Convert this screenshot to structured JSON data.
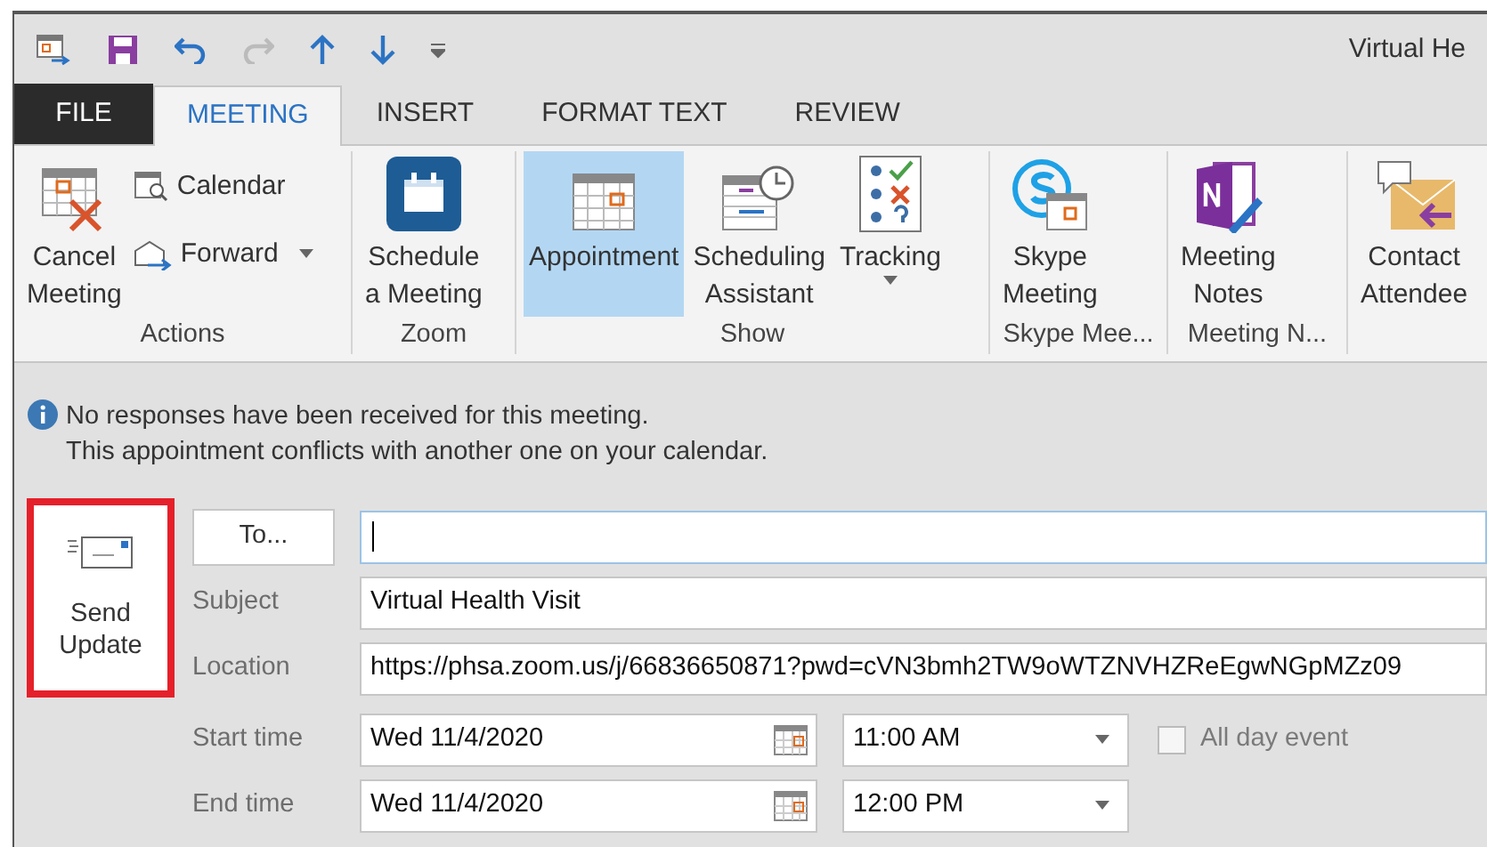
{
  "window": {
    "title": "Virtual He"
  },
  "tabs": [
    {
      "label": "FILE",
      "kind": "file",
      "selected": false
    },
    {
      "label": "MEETING",
      "kind": "tab",
      "selected": true
    },
    {
      "label": "INSERT",
      "kind": "tab",
      "selected": false
    },
    {
      "label": "FORMAT TEXT",
      "kind": "tab",
      "selected": false
    },
    {
      "label": "REVIEW",
      "kind": "tab",
      "selected": false
    }
  ],
  "ribbon": {
    "groups": [
      {
        "label": "Actions",
        "buttons": [
          {
            "kind": "large",
            "lines": [
              "Cancel",
              "Meeting"
            ],
            "selected": false
          },
          {
            "kind": "small",
            "lines": [
              "Calendar"
            ],
            "selected": false
          },
          {
            "kind": "small",
            "lines": [
              "Forward"
            ],
            "selected": false,
            "dropdown": true
          }
        ]
      },
      {
        "label": "Zoom",
        "buttons": [
          {
            "kind": "large",
            "lines": [
              "Schedule",
              "a Meeting"
            ],
            "selected": false
          }
        ]
      },
      {
        "label": "Show",
        "buttons": [
          {
            "kind": "large",
            "lines": [
              "Appointment"
            ],
            "selected": true
          },
          {
            "kind": "large",
            "lines": [
              "Scheduling",
              "Assistant"
            ],
            "selected": false
          },
          {
            "kind": "large",
            "lines": [
              "Tracking"
            ],
            "selected": false,
            "dropdown": true
          }
        ]
      },
      {
        "label": "Skype Mee...",
        "buttons": [
          {
            "kind": "large",
            "lines": [
              "Skype",
              "Meeting"
            ],
            "selected": false
          }
        ]
      },
      {
        "label": "Meeting N...",
        "buttons": [
          {
            "kind": "large",
            "lines": [
              "Meeting",
              "Notes"
            ],
            "selected": false
          }
        ]
      },
      {
        "buttons": [
          {
            "kind": "large",
            "lines": [
              "Contact",
              "Attendee"
            ],
            "selected": false
          }
        ]
      }
    ]
  },
  "info_bar": {
    "lines": [
      "No responses have been received for this meeting.",
      "This appointment conflicts with another one on your calendar."
    ]
  },
  "send_button": {
    "lines": [
      "Send",
      "Update"
    ],
    "highlighted": true
  },
  "form": {
    "to_button": "To...",
    "subject": {
      "label": "Subject",
      "value": "Virtual Health Visit"
    },
    "location": {
      "label": "Location",
      "value": "https://phsa.zoom.us/j/66836650871?pwd=cVN3bmh2TW9oWTZNVHZReEgwNGpMZz09"
    },
    "times": [
      {
        "label": "Start time",
        "date": "Wed 11/4/2020",
        "time": "11:00 AM"
      },
      {
        "label": "End time",
        "date": "Wed 11/4/2020",
        "time": "12:00 PM"
      }
    ],
    "all_day": {
      "label": "All day event",
      "checked": false
    }
  }
}
